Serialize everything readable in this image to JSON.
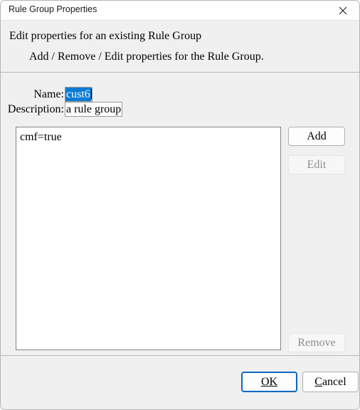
{
  "window": {
    "title": "Rule Group Properties",
    "close_icon": "close-icon"
  },
  "header": {
    "line1": "Edit properties for an existing Rule Group",
    "line2": "Add / Remove / Edit properties for the Rule Group."
  },
  "form": {
    "name": {
      "label": "Name:",
      "value": "cust6",
      "selected": true
    },
    "description": {
      "label": "Description:",
      "value": "a rule group"
    }
  },
  "list": {
    "items": [
      "cmf=true"
    ]
  },
  "side_buttons": [
    {
      "label": "Add",
      "enabled": true
    },
    {
      "label": "Edit",
      "enabled": false
    },
    {
      "label": "Remove",
      "enabled": false
    }
  ],
  "footer": {
    "ok": {
      "mnemonic": "O",
      "rest": "K"
    },
    "cancel": {
      "mnemonic": "C",
      "rest": "ancel"
    }
  },
  "colors": {
    "selection_blue": "#0a7bd4",
    "default_button_border": "#0a68c4",
    "dialog_background": "#f0f0f0",
    "disabled_text": "#8e8e94"
  }
}
